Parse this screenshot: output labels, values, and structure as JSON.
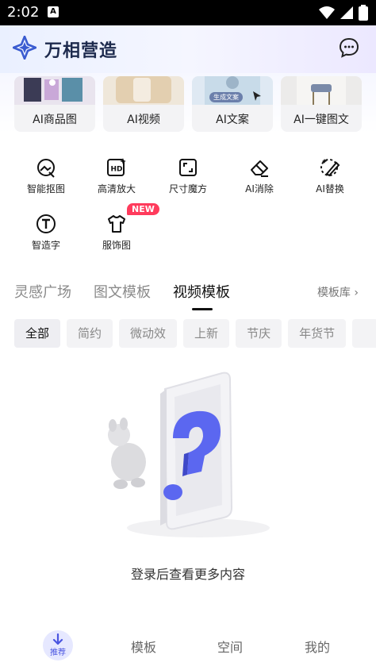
{
  "status_bar": {
    "time": "2:02",
    "notification_glyph": "A"
  },
  "header": {
    "title": "万相营造",
    "logo_icon": "brand-logo-icon",
    "message_icon": "chat-bubble-icon"
  },
  "feature_cards": [
    {
      "label": "AI商品图"
    },
    {
      "label": "AI视频"
    },
    {
      "label": "AI文案",
      "thumb_badge": "生成文案"
    },
    {
      "label": "AI一键图文"
    }
  ],
  "tools": [
    {
      "label": "智能抠图",
      "icon": "cutout-icon"
    },
    {
      "label": "高清放大",
      "icon": "hd-upscale-icon",
      "icon_text": "HD"
    },
    {
      "label": "尺寸魔方",
      "icon": "resize-icon"
    },
    {
      "label": "AI消除",
      "icon": "eraser-icon"
    },
    {
      "label": "AI替换",
      "icon": "replace-brush-icon"
    },
    {
      "label": "智造字",
      "icon": "text-t-icon",
      "icon_text": "T"
    },
    {
      "label": "服饰图",
      "icon": "tshirt-icon",
      "badge": "NEW"
    }
  ],
  "content_tabs": [
    {
      "label": "灵感广场",
      "active": false
    },
    {
      "label": "图文模板",
      "active": false
    },
    {
      "label": "视频模板",
      "active": true
    }
  ],
  "template_library_link": "模板库 ›",
  "filter_chips": [
    "全部",
    "简约",
    "微动效",
    "上新",
    "节庆",
    "年货节"
  ],
  "empty_state": {
    "message": "登录后查看更多内容"
  },
  "bottom_nav": [
    {
      "label": "推荐",
      "active": true
    },
    {
      "label": "模板"
    },
    {
      "label": "空间"
    },
    {
      "label": "我的"
    }
  ],
  "colors": {
    "accent": "#4a55e0",
    "new_badge": "#ff3b5c",
    "brand_logo": "#3a5bd0"
  }
}
